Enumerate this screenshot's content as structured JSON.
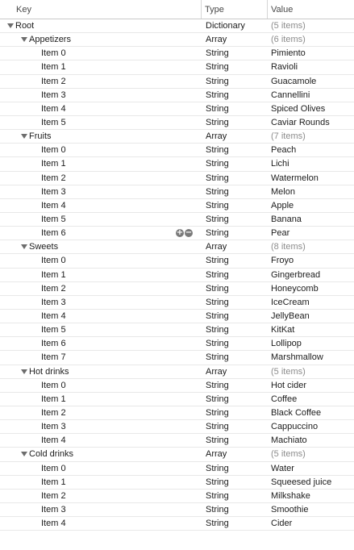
{
  "columns": {
    "key": "Key",
    "type": "Type",
    "value": "Value"
  },
  "icons": {
    "add": "plus-circle-icon",
    "remove": "minus-circle-icon",
    "disclosure": "disclosure-triangle-icon"
  },
  "rows": [
    {
      "key": "Root",
      "type": "Dictionary",
      "value": "(5 items)",
      "level": 0,
      "group": true
    },
    {
      "key": "Appetizers",
      "type": "Array",
      "value": "(6 items)",
      "level": 1,
      "group": true
    },
    {
      "key": "Item 0",
      "type": "String",
      "value": "Pimiento",
      "level": 2
    },
    {
      "key": "Item 1",
      "type": "String",
      "value": "Ravioli",
      "level": 2
    },
    {
      "key": "Item 2",
      "type": "String",
      "value": "Guacamole",
      "level": 2
    },
    {
      "key": "Item 3",
      "type": "String",
      "value": "Cannellini",
      "level": 2
    },
    {
      "key": "Item 4",
      "type": "String",
      "value": "Spiced Olives",
      "level": 2
    },
    {
      "key": "Item 5",
      "type": "String",
      "value": "Caviar Rounds",
      "level": 2
    },
    {
      "key": "Fruits",
      "type": "Array",
      "value": "(7 items)",
      "level": 1,
      "group": true
    },
    {
      "key": "Item 0",
      "type": "String",
      "value": "Peach",
      "level": 2
    },
    {
      "key": "Item 1",
      "type": "String",
      "value": "Lichi",
      "level": 2
    },
    {
      "key": "Item 2",
      "type": "String",
      "value": "Watermelon",
      "level": 2
    },
    {
      "key": "Item 3",
      "type": "String",
      "value": "Melon",
      "level": 2
    },
    {
      "key": "Item 4",
      "type": "String",
      "value": "Apple",
      "level": 2
    },
    {
      "key": "Item 5",
      "type": "String",
      "value": "Banana",
      "level": 2
    },
    {
      "key": "Item 6",
      "type": "String",
      "value": "Pear",
      "level": 2,
      "hovered": true
    },
    {
      "key": "Sweets",
      "type": "Array",
      "value": "(8 items)",
      "level": 1,
      "group": true
    },
    {
      "key": "Item 0",
      "type": "String",
      "value": "Froyo",
      "level": 2
    },
    {
      "key": "Item 1",
      "type": "String",
      "value": "Gingerbread",
      "level": 2
    },
    {
      "key": "Item 2",
      "type": "String",
      "value": "Honeycomb",
      "level": 2
    },
    {
      "key": "Item 3",
      "type": "String",
      "value": "IceCream",
      "level": 2
    },
    {
      "key": "Item 4",
      "type": "String",
      "value": "JellyBean",
      "level": 2
    },
    {
      "key": "Item 5",
      "type": "String",
      "value": "KitKat",
      "level": 2
    },
    {
      "key": "Item 6",
      "type": "String",
      "value": "Lollipop",
      "level": 2
    },
    {
      "key": "Item 7",
      "type": "String",
      "value": "Marshmallow",
      "level": 2
    },
    {
      "key": "Hot drinks",
      "type": "Array",
      "value": "(5 items)",
      "level": 1,
      "group": true
    },
    {
      "key": "Item 0",
      "type": "String",
      "value": "Hot cider",
      "level": 2
    },
    {
      "key": "Item 1",
      "type": "String",
      "value": "Coffee",
      "level": 2
    },
    {
      "key": "Item 2",
      "type": "String",
      "value": "Black Coffee",
      "level": 2
    },
    {
      "key": "Item 3",
      "type": "String",
      "value": "Cappuccino",
      "level": 2
    },
    {
      "key": "Item 4",
      "type": "String",
      "value": "Machiato",
      "level": 2
    },
    {
      "key": "Cold drinks",
      "type": "Array",
      "value": "(5 items)",
      "level": 1,
      "group": true
    },
    {
      "key": "Item 0",
      "type": "String",
      "value": "Water",
      "level": 2
    },
    {
      "key": "Item 1",
      "type": "String",
      "value": "Squeesed juice",
      "level": 2
    },
    {
      "key": "Item 2",
      "type": "String",
      "value": "Milkshake",
      "level": 2
    },
    {
      "key": "Item 3",
      "type": "String",
      "value": "Smoothie",
      "level": 2
    },
    {
      "key": "Item 4",
      "type": "String",
      "value": "Cider",
      "level": 2
    }
  ]
}
